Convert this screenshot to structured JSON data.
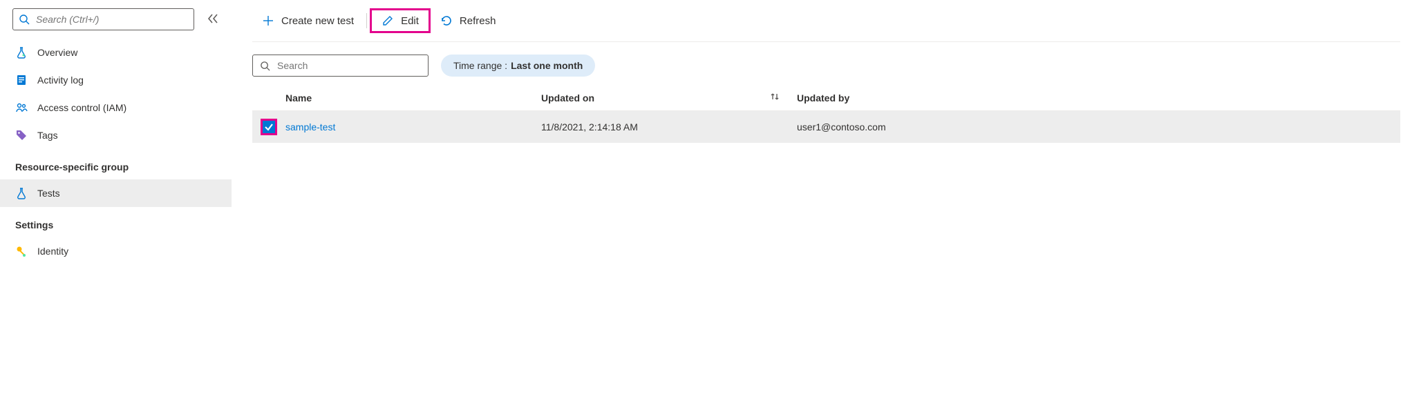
{
  "sidebar": {
    "search_placeholder": "Search (Ctrl+/)",
    "sections": {
      "top": [
        {
          "id": "overview",
          "label": "Overview"
        },
        {
          "id": "activity-log",
          "label": "Activity log"
        },
        {
          "id": "access-control",
          "label": "Access control (IAM)"
        },
        {
          "id": "tags",
          "label": "Tags"
        }
      ],
      "resource_group_header": "Resource-specific group",
      "resource_group": [
        {
          "id": "tests",
          "label": "Tests",
          "selected": true
        }
      ],
      "settings_header": "Settings",
      "settings": [
        {
          "id": "identity",
          "label": "Identity"
        }
      ]
    }
  },
  "toolbar": {
    "create_label": "Create new test",
    "edit_label": "Edit",
    "refresh_label": "Refresh"
  },
  "filters": {
    "search_placeholder": "Search",
    "time_range_label": "Time range :",
    "time_range_value": "Last one month"
  },
  "table": {
    "headers": {
      "name": "Name",
      "updated_on": "Updated on",
      "updated_by": "Updated by"
    },
    "rows": [
      {
        "checked": true,
        "name": "sample-test",
        "updated_on": "11/8/2021, 2:14:18 AM",
        "updated_by": "user1@contoso.com"
      }
    ]
  }
}
